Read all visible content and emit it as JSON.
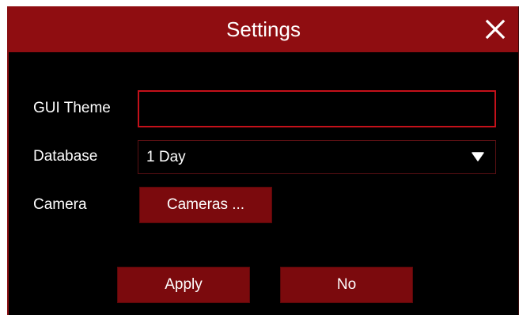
{
  "dialog": {
    "title": "Settings",
    "close_icon": "close-icon"
  },
  "form": {
    "gui_theme": {
      "label": "GUI Theme",
      "value": ""
    },
    "database": {
      "label": "Database",
      "selected": "1 Day",
      "caret_icon": "caret-down-icon"
    },
    "camera": {
      "label": "Camera",
      "button_label": "Cameras ..."
    }
  },
  "actions": {
    "apply_label": "Apply",
    "no_label": "No"
  },
  "colors": {
    "accent": "#8f0d11",
    "button": "#7b0a0d",
    "focus_border": "#c4111a",
    "background": "#000000",
    "text": "#ffffff"
  }
}
